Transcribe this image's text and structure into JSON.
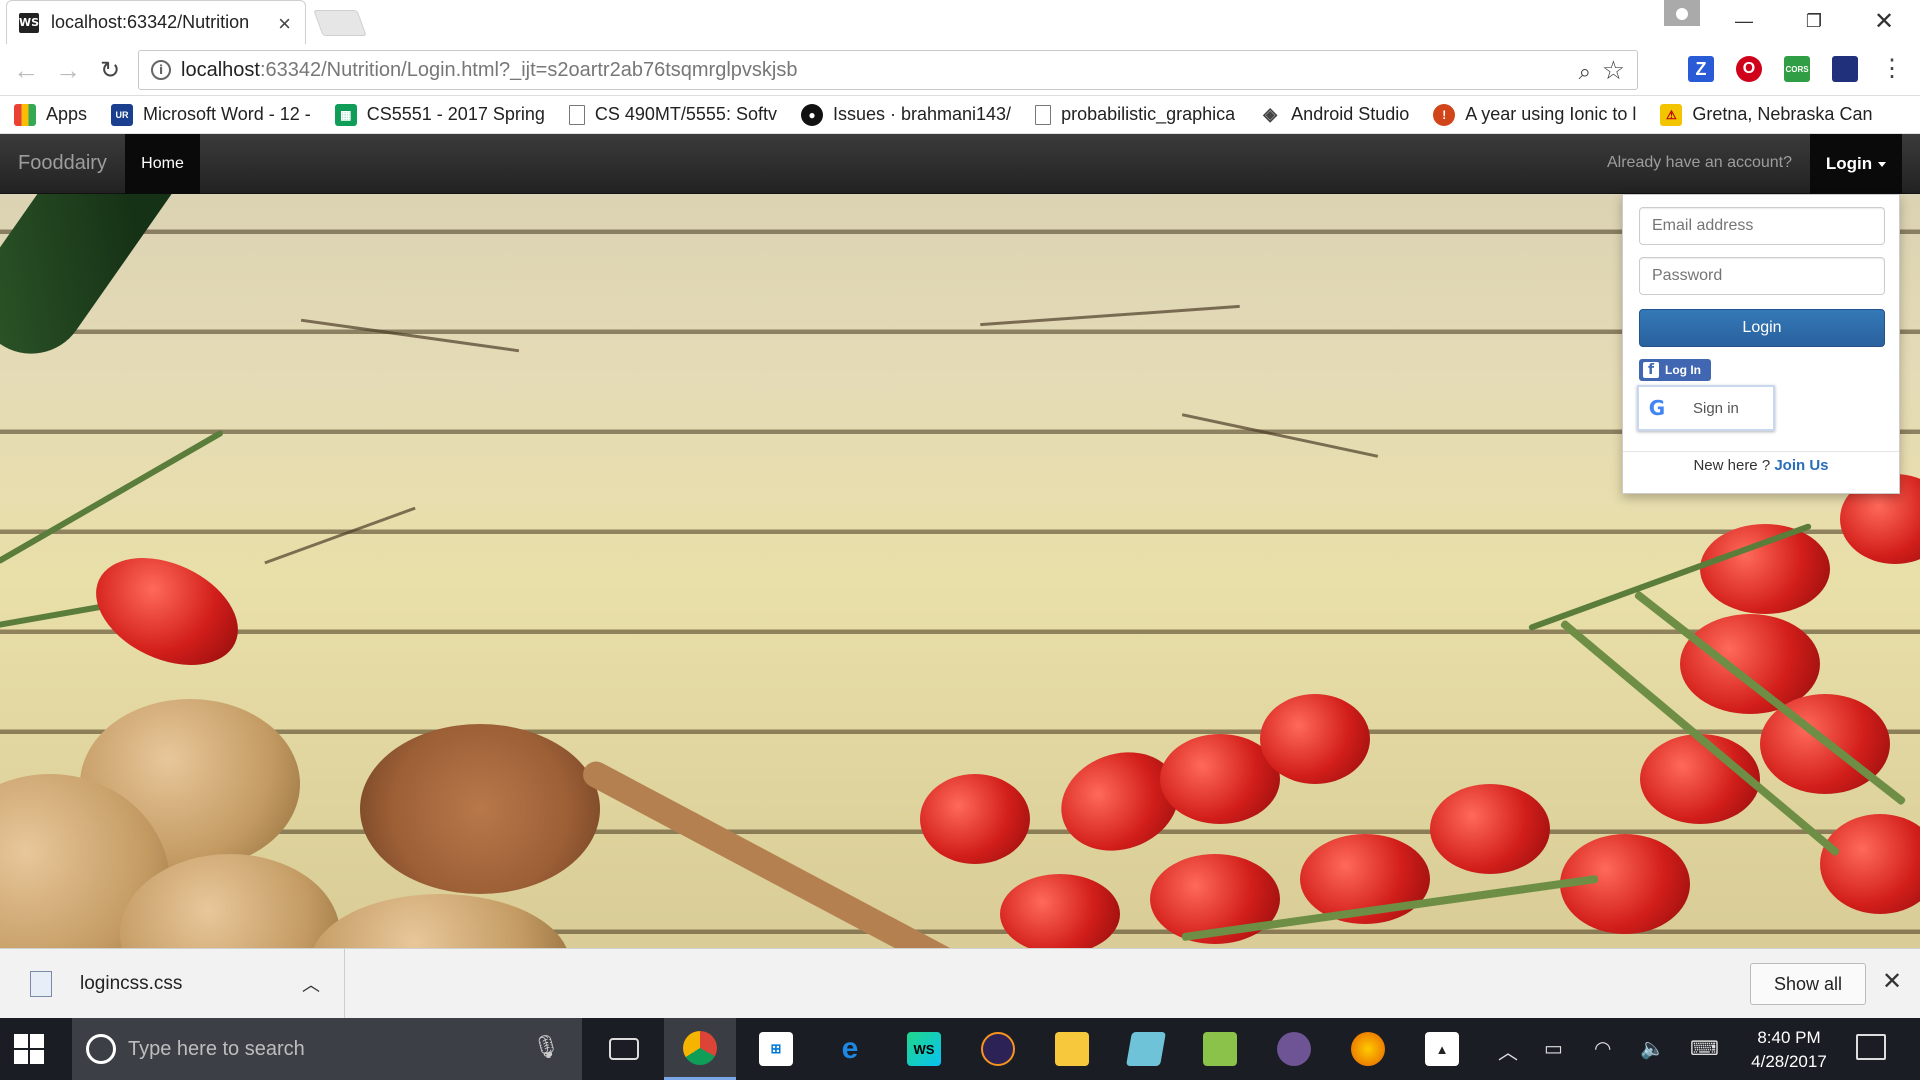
{
  "browser": {
    "tab_title": "localhost:63342/Nutrition",
    "tab_favicon": "WS",
    "url_host": "localhost",
    "url_rest": ":63342/Nutrition/Login.html?_ijt=s2oartr2ab76tsqmrglpvskjsb",
    "extensions": [
      {
        "icon": "z-extension-icon",
        "glyph": "Z",
        "color": "#2a5bd7"
      },
      {
        "icon": "opera-extension-icon",
        "glyph": "O",
        "color": "#d0021b"
      },
      {
        "icon": "cors-extension-icon",
        "glyph": "CORS",
        "color": "#2f9e44"
      },
      {
        "icon": "flag-extension-icon",
        "glyph": "",
        "color": "#20307a"
      }
    ]
  },
  "bookmarks": [
    {
      "label": "Apps",
      "icon": "apps-grid-icon"
    },
    {
      "label": "Microsoft Word - 12 -",
      "icon": "umkc-icon"
    },
    {
      "label": "CS5551 - 2017 Spring",
      "icon": "sheets-icon"
    },
    {
      "label": "CS 490MT/5555: Softv",
      "icon": "page-icon"
    },
    {
      "label": "Issues · brahmani143/",
      "icon": "github-icon"
    },
    {
      "label": "probabilistic_graphica",
      "icon": "page-icon"
    },
    {
      "label": "Android Studio",
      "icon": "android-studio-icon"
    },
    {
      "label": "A year using Ionic to l",
      "icon": "ionic-icon"
    },
    {
      "label": "Gretna, Nebraska Can",
      "icon": "warning-icon"
    }
  ],
  "navbar": {
    "brand": "Fooddairy",
    "home": "Home",
    "question": "Already have an account?",
    "login": "Login"
  },
  "login_form": {
    "email_placeholder": "Email address",
    "password_placeholder": "Password",
    "submit": "Login",
    "facebook": "Log In",
    "google": "Sign in",
    "new_here": "New here ?",
    "join": "Join Us"
  },
  "downloads": {
    "file": "logincss.css",
    "show_all": "Show all"
  },
  "taskbar": {
    "search_placeholder": "Type here to search",
    "time": "8:40 PM",
    "date": "4/28/2017"
  }
}
